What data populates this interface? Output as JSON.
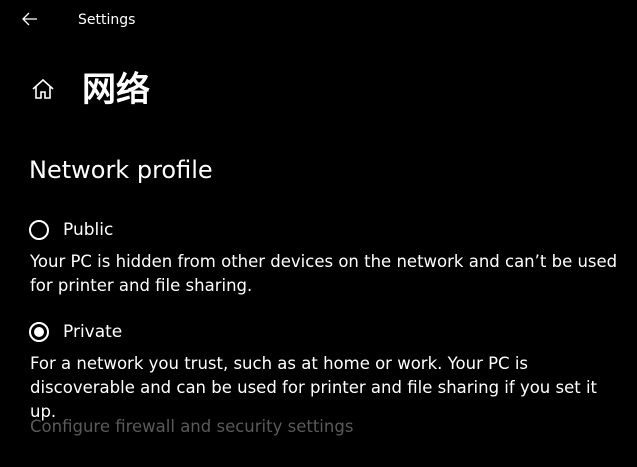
{
  "titlebar": {
    "title": "Settings",
    "back_icon": "back-arrow-icon"
  },
  "header": {
    "home_icon": "home-icon",
    "title": "网络"
  },
  "network_profile": {
    "heading": "Network profile",
    "options": [
      {
        "label": "Public",
        "selected": false,
        "description": "Your PC is hidden from other devices on the network and can’t be used for printer and file sharing."
      },
      {
        "label": "Private",
        "selected": true,
        "description": "For a network you trust, such as at home or work. Your PC is discoverable and can be used for printer and file sharing if you set it up."
      }
    ],
    "firewall_link": "Configure firewall and security settings"
  },
  "colors": {
    "background": "#000000",
    "text": "#ffffff",
    "link_disabled": "#5a5a5a"
  }
}
